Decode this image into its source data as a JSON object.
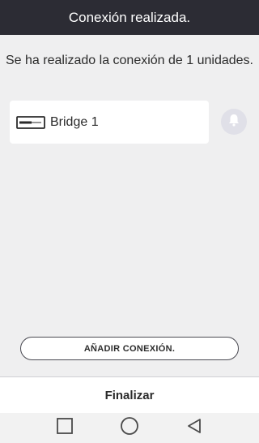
{
  "header": {
    "title": "Conexión realizada."
  },
  "message": "Se ha realizado la conexión de 1 unidades.",
  "devices": [
    {
      "name": "Bridge 1",
      "icon": "bridge-device-icon"
    }
  ],
  "notification_icon": "bell-icon",
  "add_button_label": "AÑADIR CONEXIÓN.",
  "footer": {
    "finish_label": "Finalizar"
  },
  "navbar": {
    "icons": [
      "recent-apps-icon",
      "home-icon",
      "back-icon"
    ]
  },
  "colors": {
    "header_bg": "#2c2c34",
    "background": "#efeff0",
    "bell_bg": "#e0e0e8"
  }
}
